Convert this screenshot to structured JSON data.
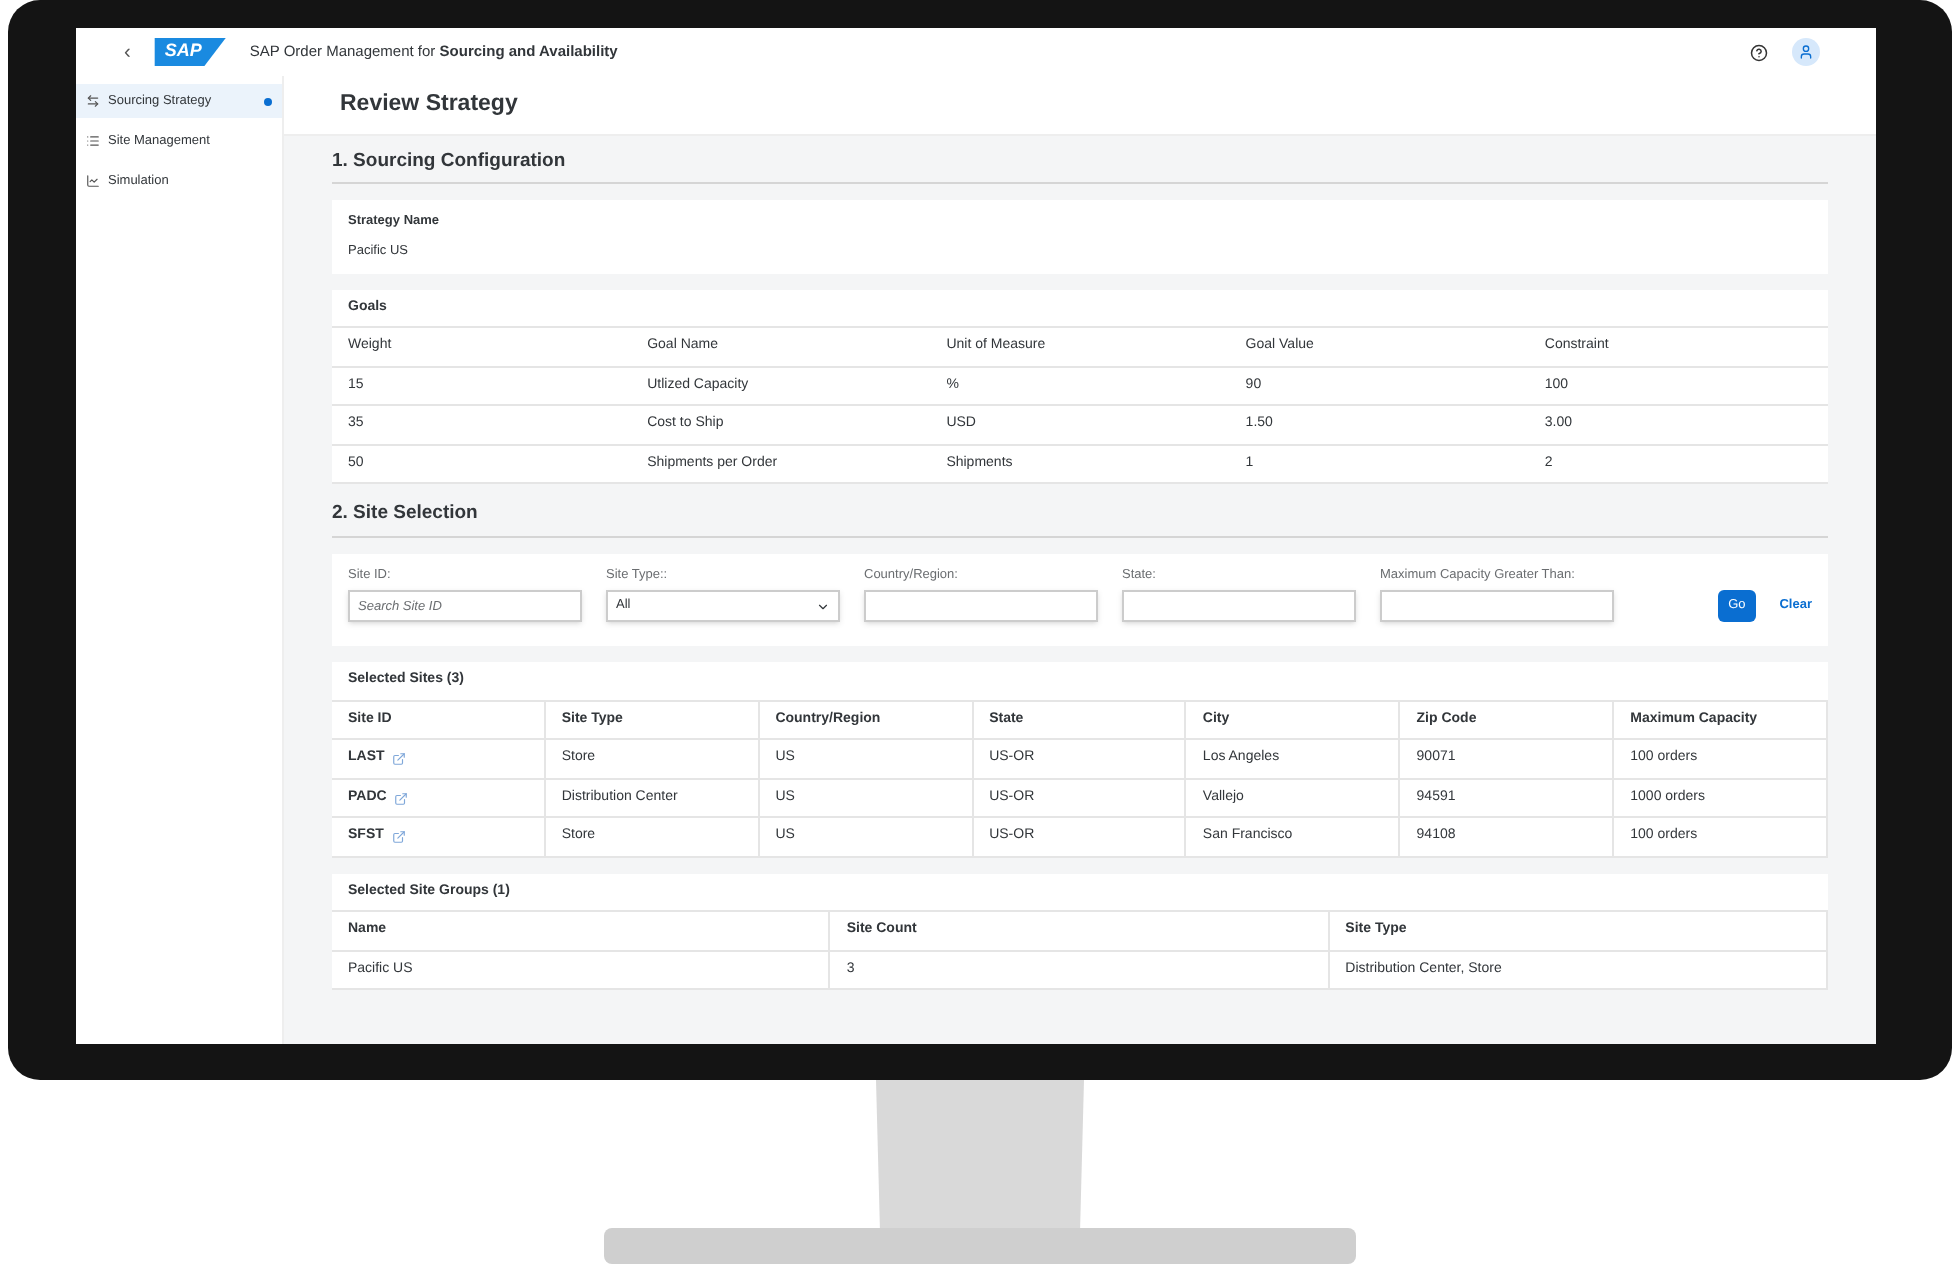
{
  "shell_bar": {
    "back": "‹",
    "logo": "SAP",
    "title": "SAP Order Management for **Sourcing and Availability**"
  },
  "sidebar": {
    "items": [
      {
        "label": "Sourcing Strategy",
        "selected": true
      },
      {
        "label": "Site Management",
        "selected": false
      },
      {
        "label": "Simulation",
        "selected": false
      }
    ]
  },
  "page_title": "Review Strategy",
  "section_1": {
    "heading": "1. Sourcing Configuration",
    "strategy_label": "Strategy Name",
    "strategy_value": "Pacific US",
    "goals": {
      "title": "Goals",
      "columns": [
        "Weight",
        "Goal Name",
        "Unit of Measure",
        "Goal Value",
        "Constraint"
      ],
      "rows": [
        [
          "15",
          "Utlized Capacity",
          "%",
          "90",
          "100"
        ],
        [
          "35",
          "Cost to Ship",
          "USD",
          "1.50",
          "3.00"
        ],
        [
          "50",
          "Shipments per Order",
          "Shipments",
          "1",
          "2"
        ]
      ]
    }
  },
  "section_2": {
    "heading": "2. Site Selection",
    "filters": [
      {
        "kind": "input",
        "label": "Site ID:",
        "placeholder": "Search Site ID"
      },
      {
        "kind": "select",
        "label": "Site Type::",
        "value": "All"
      },
      {
        "kind": "input",
        "label": "Country/Region:"
      },
      {
        "kind": "input",
        "label": "State:"
      },
      {
        "kind": "input",
        "label": "Maximum Capacity Greater Than:"
      }
    ],
    "go_button": "Go",
    "clear_link": "Clear",
    "selected_sites": {
      "title": "Selected Sites (3)",
      "columns": [
        "Site ID",
        "Site Type",
        "Country/Region",
        "State",
        "City",
        "Zip Code",
        "Maximum Capacity"
      ],
      "rows": [
        [
          "LAST",
          "Store",
          "US",
          "US-OR",
          "Los Angeles",
          "90071",
          "100 orders"
        ],
        [
          "PADC",
          "Distribution Center",
          "US",
          "US-OR",
          "Vallejo",
          "94591",
          "1000 orders"
        ],
        [
          "SFST",
          "Store",
          "US",
          "US-OR",
          "San Francisco",
          "94108",
          "100 orders"
        ]
      ]
    },
    "selected_site_groups": {
      "title": "Selected Site Groups (1)",
      "columns": [
        "Name",
        "Site Count",
        "Site Type"
      ],
      "rows": [
        [
          "Pacific US",
          "3",
          "Distribution Center, Store"
        ]
      ]
    }
  }
}
